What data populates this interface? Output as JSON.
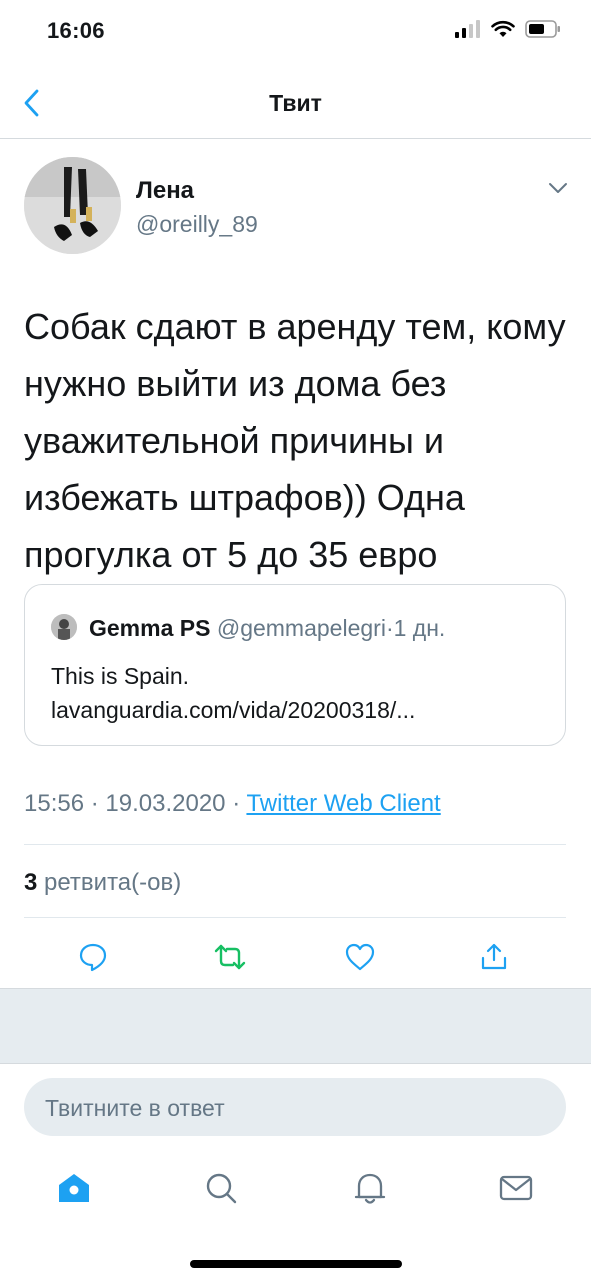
{
  "status_bar": {
    "time": "16:06",
    "icons": [
      "signal-icon",
      "wifi-icon",
      "battery-icon"
    ]
  },
  "nav": {
    "title": "Твит",
    "back_icon": "chevron-left-icon"
  },
  "tweet": {
    "author_name": "Лена",
    "author_handle": "@oreilly_89",
    "text": "Собак сдают в аренду тем, кому нужно выйти из дома без уважительной причины и избежать штрафов)) Одна прогулка от 5 до 35 евро",
    "quote": {
      "name": "Gemma PS",
      "handle": "@gemmapelegri",
      "separator": "·",
      "time": "1 дн.",
      "body": "This is Spain.  lavanguardia.com/vida/20200318/..."
    },
    "time": "15:56",
    "dot": "·",
    "date": "19.03.2020",
    "source": "Twitter Web Client",
    "retweet_count": "3",
    "retweet_label": "ретвита(-ов)"
  },
  "actions": [
    "reply-icon",
    "retweet-icon",
    "like-icon",
    "share-icon"
  ],
  "reply": {
    "placeholder": "Твитните в ответ"
  },
  "tabs": [
    "home-icon",
    "search-icon",
    "notifications-icon",
    "messages-icon"
  ],
  "colors": {
    "accent": "#1da1f2",
    "retweet": "#17bf63",
    "secondary_text": "#657786",
    "divider": "#e1e8ed"
  }
}
